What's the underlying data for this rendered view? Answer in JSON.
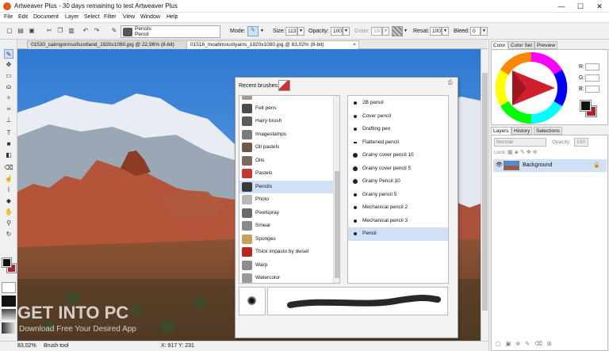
{
  "window": {
    "title": "Artweaver Plus - 30 days remaining to test Artweaver Plus",
    "minimize": "—",
    "maximize": "☐",
    "close": "✕"
  },
  "menu": [
    "File",
    "Edit",
    "Document",
    "Layer",
    "Select",
    "Filter",
    "View",
    "Window",
    "Help"
  ],
  "options": {
    "brush_category": "Pencils",
    "brush_variant": "Pencil",
    "mode_label": "Mode:",
    "size_label": "Size:",
    "size_value": "113",
    "opacity_label": "Opacity:",
    "opacity_value": "100",
    "grain_label": "Grain:",
    "grain_value": "100",
    "resat_label": "Resat:",
    "resat_value": "100",
    "bleed_label": "Bleed:",
    "bleed_value": "0"
  },
  "tabs": [
    {
      "label": "01530_cairngormsofscotland_1920x1080.jpg @ 22,96% (8-bit)",
      "close": "×"
    },
    {
      "label": "01516_moabmountyains_1920x1080.jpg @ 83,02% (8-bit)",
      "close": "×"
    }
  ],
  "brush_popup": {
    "recent_label": "Recent brushes:",
    "categories": [
      {
        "label": "Erasers",
        "color": "#a79b8f"
      },
      {
        "label": "Felt pens",
        "color": "#4b4b4b"
      },
      {
        "label": "Hairy brush",
        "color": "#5a5a5a"
      },
      {
        "label": "Imagestamps",
        "color": "#7a7a7a"
      },
      {
        "label": "Oil pastels",
        "color": "#6d5a4a"
      },
      {
        "label": "Oils",
        "color": "#7b6a5d"
      },
      {
        "label": "Pastels",
        "color": "#c2392f"
      },
      {
        "label": "Pencils",
        "color": "#3a3a3a"
      },
      {
        "label": "Photo",
        "color": "#b8b8b8"
      },
      {
        "label": "Pixelspray",
        "color": "#6a6a6a"
      },
      {
        "label": "Smear",
        "color": "#8a8a8a"
      },
      {
        "label": "Sponges",
        "color": "#c8a05a"
      },
      {
        "label": "Thick impasto by dwsel",
        "color": "#b5291f"
      },
      {
        "label": "Warp",
        "color": "#8c8c8c"
      },
      {
        "label": "Watercolor",
        "color": "#9a9a9a"
      }
    ],
    "selected_category": "Pencils",
    "variants": [
      {
        "label": "2B pencil",
        "marker": "small"
      },
      {
        "label": "Cover pencil",
        "marker": "small"
      },
      {
        "label": "Drafting pen",
        "marker": "small"
      },
      {
        "label": "Flattened pencil",
        "marker": "bar"
      },
      {
        "label": "Grainy cover pencil 10",
        "marker": "large"
      },
      {
        "label": "Grainy cover pencil 5",
        "marker": "large"
      },
      {
        "label": "Grainy Pencil 10",
        "marker": "large"
      },
      {
        "label": "Grainy pencil 5",
        "marker": "small"
      },
      {
        "label": "Mechanical pencil 2",
        "marker": "small"
      },
      {
        "label": "Mechanical pencil 3",
        "marker": "small"
      },
      {
        "label": "Pencil",
        "marker": "small"
      }
    ],
    "selected_variant": "Pencil"
  },
  "right_panel": {
    "color_tabs": [
      "Color",
      "Color Set",
      "Preview"
    ],
    "channels": [
      {
        "label": "R:",
        "value": ""
      },
      {
        "label": "G:",
        "value": ""
      },
      {
        "label": "B:",
        "value": ""
      }
    ],
    "layer_tabs": [
      "Layers",
      "History",
      "Selections"
    ],
    "blend_mode": "Normal",
    "opacity_label": "Opacity:",
    "opacity_value": "100",
    "lock_label": "Lock:",
    "layers": [
      {
        "name": "Background"
      }
    ]
  },
  "status": {
    "zoom": "83,02%",
    "tool": "Brush tool",
    "coords": "X: 917  Y: 231"
  },
  "watermark": {
    "line1": "GET INTO PC",
    "line2": "Download Free Your Desired App"
  },
  "colors": {
    "accent_selection": "#cfe0f7",
    "foreground": "#111111",
    "background": "#b52020"
  }
}
